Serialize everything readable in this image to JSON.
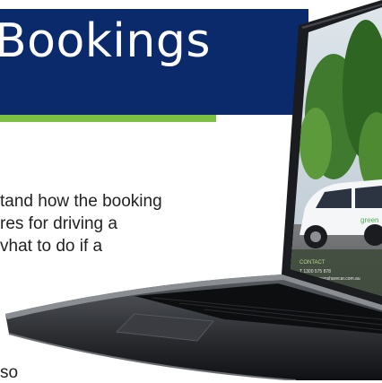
{
  "header": {
    "title": "Bookings"
  },
  "body": {
    "lines": [
      "tand how the booking",
      "res for driving a",
      "vhat to do if a"
    ],
    "trailing": "so"
  },
  "laptop_screen": {
    "section_label": "CONTACT",
    "phone": "T 1300 575 878",
    "email": "E info@greensharecar.com.au",
    "car_logo": "green"
  },
  "colors": {
    "banner": "#0b2a6c",
    "accent": "#7cc142",
    "car_brand": "#4caf50"
  }
}
